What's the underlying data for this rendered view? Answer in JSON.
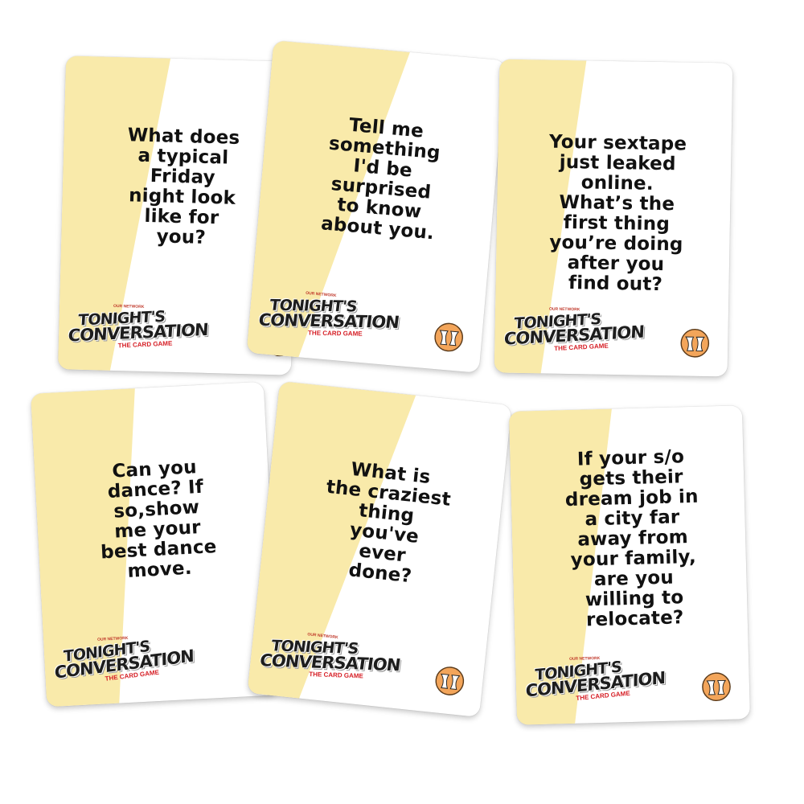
{
  "brand": {
    "logo_line1": "TONIGHT'S",
    "logo_line2": "CONVERSATION",
    "logo_tagline": "THE CARD GAME",
    "logo_prefix": "OUR NETWORK",
    "card_colors": {
      "stripe": "#f9eaaa",
      "base": "#ffffff",
      "text": "#111111",
      "face_bg": "#f3a55a",
      "logo_accent": "#d61f26"
    }
  },
  "cards": [
    {
      "question": "What does\na typical\nFriday\nnight look\nlike for\nyou?"
    },
    {
      "question": "Tell me\nsomething\nI'd be\nsurprised\nto know\nabout you."
    },
    {
      "question": "Your sextape\njust leaked\nonline.\nWhat’s the\nfirst thing\nyou’re doing\nafter you\nfind out?"
    },
    {
      "question": "Can you\ndance? If\nso,show\nme your\nbest dance\nmove."
    },
    {
      "question": "What is\nthe craziest\nthing\nyou've\never\ndone?"
    },
    {
      "question": "If your s/o\ngets their\ndream job in\na city far\naway from\nyour family,\nare you\nwilling to\nrelocate?"
    }
  ]
}
